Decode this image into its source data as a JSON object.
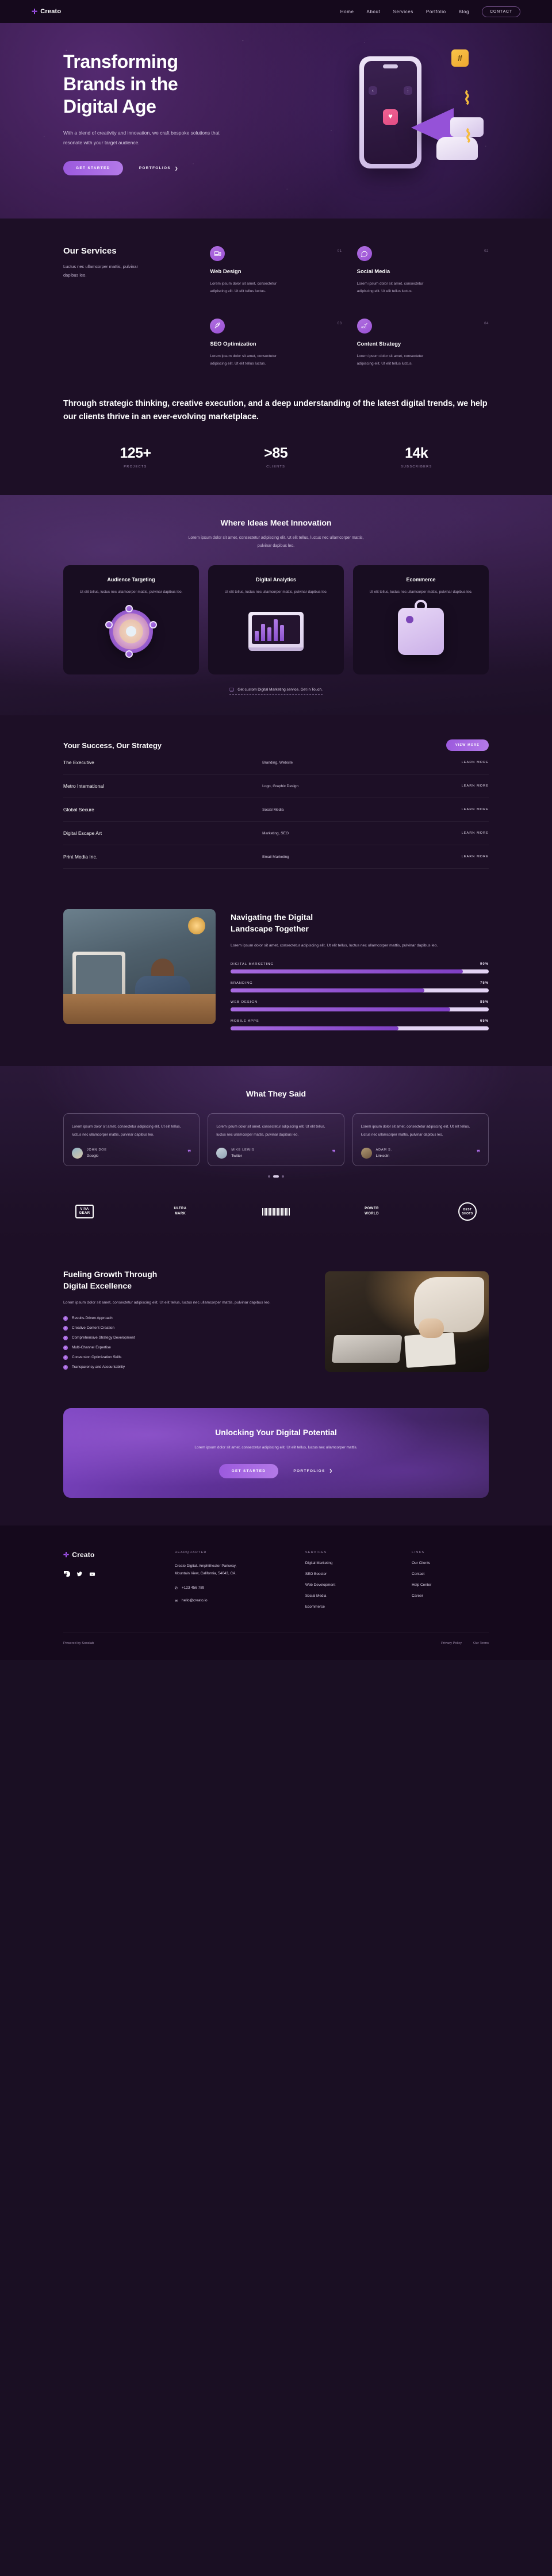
{
  "brand": {
    "name": "Creato",
    "mark": "✛"
  },
  "topnav": {
    "items": [
      "Home",
      "About",
      "Services",
      "Portfolio",
      "Blog"
    ],
    "contact_label": "CONTACT"
  },
  "hero": {
    "title_line1": "Transforming",
    "title_line2": "Brands in the",
    "title_line3": "Digital Age",
    "paragraph": "With a blend of creativity and innovation, we craft bespoke solutions that resonate with your target audience.",
    "primary_cta": "GET STARTED",
    "secondary_cta": "PORTFOLIOS",
    "secondary_arrow": "❯"
  },
  "services": {
    "title": "Our Services",
    "subtitle": "Luctus nec ullamcorper mattis, pulvinar dapibus leo.",
    "items": [
      {
        "num": "01",
        "icon": "devices-icon",
        "title": "Web Design",
        "desc": "Lorem ipsum dolor sit amet, consectetur adipiscing elit. Ut elit tellus luctus."
      },
      {
        "num": "02",
        "icon": "chat-bubble-icon",
        "title": "Social Media",
        "desc": "Lorem ipsum dolor sit amet, consectetur adipiscing elit. Ut elit tellus luctus."
      },
      {
        "num": "03",
        "icon": "rocket-icon",
        "title": "SEO Optimization",
        "desc": "Lorem ipsum dolor sit amet, consectetur adipiscing elit. Ut elit tellus luctus."
      },
      {
        "num": "04",
        "icon": "abc-check-icon",
        "title": "Content Strategy",
        "desc": "Lorem ipsum dolor sit amet, consectetur adipiscing elit. Ut elit tellus luctus."
      }
    ]
  },
  "statement": {
    "text": "Through strategic thinking, creative execution, and a deep understanding of the latest digital trends, we help our clients thrive in an ever-evolving marketplace.",
    "stats": [
      {
        "value": "125+",
        "label": "PROJECTS"
      },
      {
        "value": ">85",
        "label": "CLIENTS"
      },
      {
        "value": "14k",
        "label": "SUBSCRIBERS"
      }
    ]
  },
  "innovation": {
    "title": "Where Ideas Meet Innovation",
    "subtitle": "Lorem ipsum dolor sit amet, consectetur adipiscing elit. Ut elit tellus, luctus nec ullamcorper mattis, pulvinar dapibus leo.",
    "cards": [
      {
        "title": "Audience Targeting",
        "desc": "Ut elit tellus, luctus nec ullamcorper mattis, pulvinar dapibus leo."
      },
      {
        "title": "Digital Analytics",
        "desc": "Ut elit tellus, luctus nec ullamcorper mattis, pulvinar dapibus leo."
      },
      {
        "title": "Ecommerce",
        "desc": "Ut elit tellus, luctus nec ullamcorper mattis, pulvinar dapibus leo."
      }
    ],
    "note": "Get custom Digital Marketing service. Get in Touch."
  },
  "strategy": {
    "title": "Your Success, Our Strategy",
    "view_more": "VIEW MORE",
    "link_label": "LEARN MORE",
    "rows": [
      {
        "name": "The Executive",
        "tags": "Branding, Website"
      },
      {
        "name": "Metro International",
        "tags": "Logo, Graphic Design"
      },
      {
        "name": "Global Secure",
        "tags": "Social Media"
      },
      {
        "name": "Digital Escape Art",
        "tags": "Marketing, SEO"
      },
      {
        "name": "Print Media Inc.",
        "tags": "Email Marketing"
      }
    ]
  },
  "navigating": {
    "title_line1": "Navigating the Digital",
    "title_line2": "Landscape Together",
    "paragraph": "Lorem ipsum dolor sit amet, consectetur adipiscing elit. Ut elit tellus, luctus nec ullamcorper mattis, pulvinar dapibus leo.",
    "skills": [
      {
        "label": "DIGITAL MARKETING",
        "percent": "90%",
        "value": 90
      },
      {
        "label": "BRANDING",
        "percent": "75%",
        "value": 75
      },
      {
        "label": "WEB DESIGN",
        "percent": "85%",
        "value": 85
      },
      {
        "label": "MOBILE APPS",
        "percent": "65%",
        "value": 65
      }
    ]
  },
  "testimonials": {
    "title": "What They Said",
    "cards": [
      {
        "quote": "Lorem ipsum dolor sit amet, consectetur adipiscing elit. Ut elit tellus, luctus nec ullamcorper mattis, pulvinar dapibus leo.",
        "name": "JOHN DOE",
        "company": "Google"
      },
      {
        "quote": "Lorem ipsum dolor sit amet, consectetur adipiscing elit. Ut elit tellus, luctus nec ullamcorper mattis, pulvinar dapibus leo.",
        "name": "MIKE LEWIS",
        "company": "Twitter"
      },
      {
        "quote": "Lorem ipsum dolor sit amet, consectetur adipiscing elit. Ut elit tellus, luctus nec ullamcorper mattis, pulvinar dapibus leo.",
        "name": "ADAM S.",
        "company": "Linkedin"
      }
    ],
    "quote_mark": "❞"
  },
  "logos": [
    {
      "line1": "VIVA",
      "line2": "GEAR"
    },
    {
      "line1": "ULTRA",
      "line2": "MARK"
    },
    {
      "line1": "",
      "line2": ""
    },
    {
      "line1": "POWER",
      "line2": "WORLD"
    },
    {
      "line1": "BEST",
      "line2": "SHOTS"
    }
  ],
  "fueling": {
    "title_line1": "Fueling Growth Through",
    "title_line2": "Digital Excellence",
    "paragraph": "Lorem ipsum dolor sit amet, consectetur adipiscing elit. Ut elit tellus, luctus nec ullamcorper mattis, pulvinar dapibus leo.",
    "bullets": [
      "Results-Driven Approach",
      "Creative Content Creation",
      "Comprehensive Strategy Development",
      "Multi-Channel Expertise",
      "Conversion Optimization Skills",
      "Transparency and Accountability"
    ]
  },
  "cta": {
    "title": "Unlocking Your Digital Potential",
    "paragraph": "Lorem ipsum dolor sit amet, consectetur adipiscing elit. Ut elit tellus, luctus nec ullamcorper mattis.",
    "primary": "GET STARTED",
    "secondary": "PORTFOLIOS",
    "secondary_arrow": "❯"
  },
  "footer": {
    "headquarter_title": "HEADQUARTER",
    "address": "Creato Digital. Amphitheater Parkway, Mountain View, California, 54043, CA.",
    "phone": "+123 456 789",
    "email": "hello@creato.io",
    "services_title": "SERVICES",
    "services": [
      "Digital Marketing",
      "SEO Booster",
      "Web Development",
      "Social Media",
      "Ecommerce"
    ],
    "links_title": "LINKS",
    "links": [
      "Our Clients",
      "Contact",
      "Help Center",
      "Career"
    ],
    "copyright": "Powered by Sooslab",
    "privacy": "Privacy Policy",
    "terms": "Our Terms"
  },
  "colors": {
    "accent": "#9b59dd",
    "accent_light": "#b47ae8",
    "bg_dark": "#1d0f26",
    "bg_darker": "#15091c"
  }
}
